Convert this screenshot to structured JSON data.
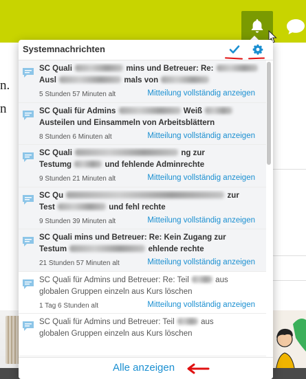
{
  "background": {
    "text_line_1": "n.",
    "text_line_2": "n"
  },
  "header": {
    "bell_icon": "bell-icon",
    "chat_icon": "chat-bubble-icon"
  },
  "panel": {
    "title": "Systemnachrichten",
    "mark_read_icon": "checkmark-icon",
    "settings_icon": "gear-icon",
    "items": [
      {
        "unread": true,
        "subject_start": "SC Quali",
        "subject_mid": "mins und Betreuer: Re:",
        "subject_line2": "Ausl",
        "subject_line2_mid": "mals von",
        "age": "5 Stunden 57 Minuten alt",
        "link": "Mitteilung vollständig anzeigen"
      },
      {
        "unread": true,
        "subject_start": "SC Quali für Admins",
        "subject_mid": "Weiß",
        "subject_line2": "Austeilen und Einsammeln von Arbeitsblättern",
        "subject_line2_mid": "",
        "age": "8 Stunden 6 Minuten alt",
        "link": "Mitteilung vollständig anzeigen"
      },
      {
        "unread": true,
        "subject_start": "SC Quali",
        "subject_mid": "ng zur",
        "subject_line2": "Testumg",
        "subject_line2_mid": "und fehlende Adminrechte",
        "age": "9 Stunden 21 Minuten alt",
        "link": "Mitteilung vollständig anzeigen"
      },
      {
        "unread": true,
        "subject_start": "SC Qu",
        "subject_mid": "zur",
        "subject_line2": "Test",
        "subject_line2_mid": "und fehl   rechte",
        "age": "9 Stunden 39 Minuten alt",
        "link": "Mitteilung vollständig anzeigen"
      },
      {
        "unread": true,
        "subject_start": "SC Quali",
        "subject_mid": "mins und Betreuer: Re: Kein Zugang zur",
        "subject_line2": "Testum",
        "subject_line2_mid": "ehlende   rechte",
        "age": "21 Stunden 57 Minuten alt",
        "link": "Mitteilung vollständig anzeigen"
      },
      {
        "unread": false,
        "subject_start": "SC Quali für Admins und Betreuer: Re: Teil",
        "subject_mid": "aus",
        "subject_line2": "globalen Gruppen",
        "subject_line2_mid": "einzeln aus Kurs löschen",
        "age": "1 Tag 6 Stunden alt",
        "link": "Mitteilung vollständig anzeigen"
      },
      {
        "unread": false,
        "subject_start": "SC Quali für Admins und Betreuer: Teil",
        "subject_mid": "aus",
        "subject_line2": "globalen Gruppen einzeln aus Kurs löschen",
        "subject_line2_mid": "",
        "age": "",
        "link": ""
      }
    ],
    "footer_link": "Alle anzeigen"
  },
  "colors": {
    "topbar": "#c8d400",
    "bell_button": "#7a9a01",
    "link_blue": "#1a8fd1",
    "annotation_red": "#e01010"
  }
}
